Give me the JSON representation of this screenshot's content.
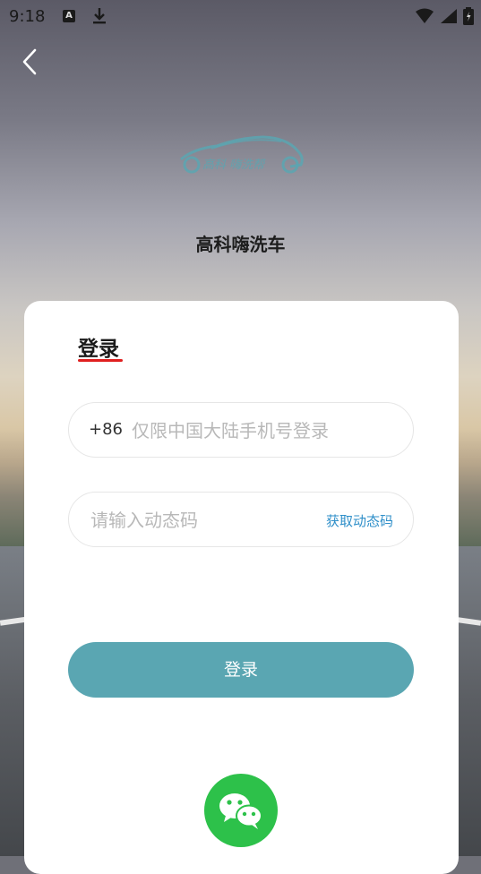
{
  "status_bar": {
    "time": "9:18",
    "notification_letter": "A"
  },
  "header": {
    "logo_text": "高科 嗨洗帮",
    "brand_name": "高科嗨洗车"
  },
  "login_card": {
    "title": "登录",
    "phone": {
      "prefix": "+86",
      "placeholder": "仅限中国大陆手机号登录"
    },
    "code": {
      "placeholder": "请输入动态码",
      "get_code_label": "获取动态码"
    },
    "login_button_label": "登录"
  },
  "colors": {
    "accent": "#5aa6b2",
    "link": "#2f8fc9",
    "underline": "#e02020",
    "wechat": "#2dc14a"
  }
}
